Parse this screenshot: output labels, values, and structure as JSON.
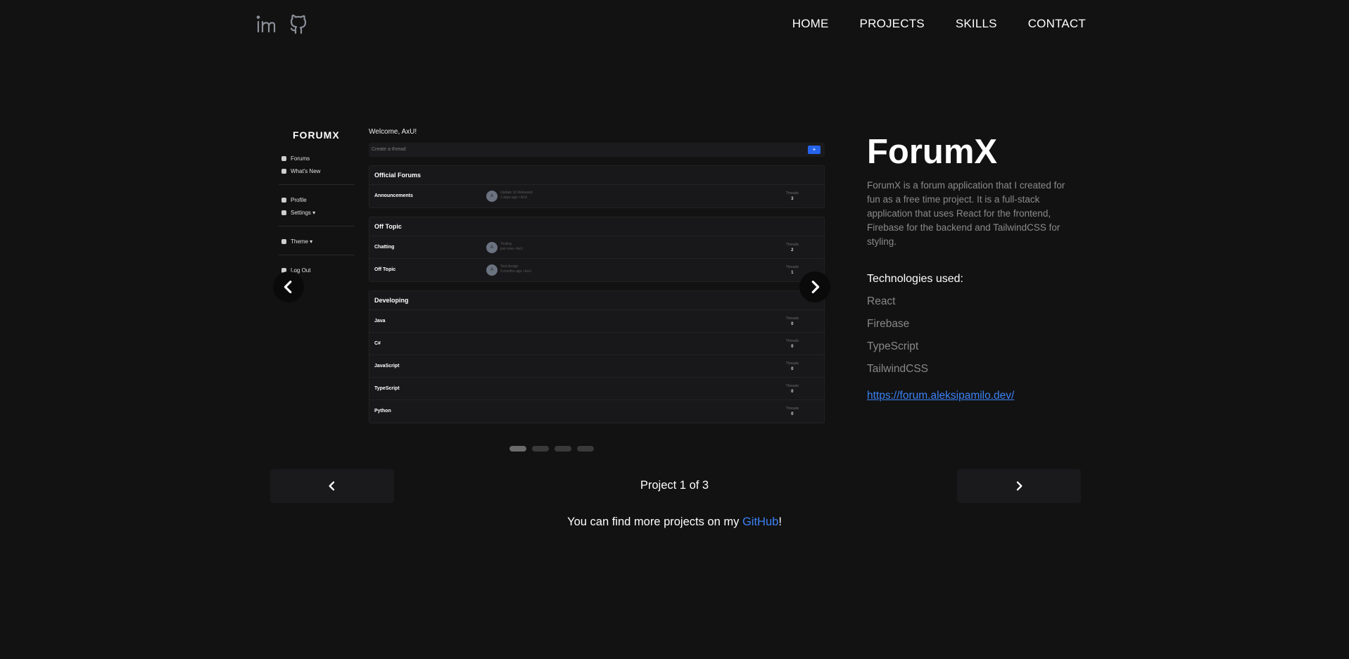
{
  "header": {
    "social": [
      {
        "icon": "linkedin-icon"
      },
      {
        "icon": "github-icon"
      }
    ],
    "nav": [
      "HOME",
      "PROJECTS",
      "SKILLS",
      "CONTACT"
    ]
  },
  "carousel": {
    "slide_count": 4,
    "active_slide": 0,
    "screenshot": {
      "logo": "FORUMX",
      "sidebar": [
        {
          "label": "Forums"
        },
        {
          "label": "What's New"
        },
        {
          "label": "Profile"
        },
        {
          "label": "Settings ▾"
        },
        {
          "label": "Theme ▾"
        },
        {
          "label": "Log Out"
        }
      ],
      "welcome": "Welcome, AxU!",
      "create_placeholder": "Create a thread",
      "create_button": "+",
      "threads_label": "Threads",
      "sections": [
        {
          "title": "Official Forums",
          "rows": [
            {
              "name": "Announcements",
              "avatar": "A",
              "meta1": "Update 10 Released",
              "meta2": "1 days ago • AxU",
              "threads": "3"
            }
          ]
        },
        {
          "title": "Off Topic",
          "rows": [
            {
              "name": "Chatting",
              "avatar": "A",
              "meta1": "Testing",
              "meta2": "just now • AxU",
              "threads": "2"
            },
            {
              "name": "Off Topic",
              "avatar": "A",
              "meta1": "Test design",
              "meta2": "5 months ago • AxU",
              "threads": "1"
            }
          ]
        },
        {
          "title": "Developing",
          "rows": [
            {
              "name": "Java",
              "threads": "0"
            },
            {
              "name": "C#",
              "threads": "0"
            },
            {
              "name": "JavaScript",
              "threads": "0"
            },
            {
              "name": "TypeScript",
              "threads": "0"
            },
            {
              "name": "Python",
              "threads": "0"
            }
          ]
        }
      ]
    }
  },
  "project": {
    "title": "ForumX",
    "description": "ForumX is a forum application that I created for fun as a free time project. It is a full-stack application that uses React for the frontend, Firebase for the backend and TailwindCSS for styling.",
    "tech_heading": "Technologies used:",
    "technologies": [
      "React",
      "Firebase",
      "TypeScript",
      "TailwindCSS"
    ],
    "link": "https://forum.aleksipamilo.dev/"
  },
  "pager": {
    "counter": "Project 1 of 3",
    "more_prefix": "You can find more projects on my ",
    "more_link": "GitHub",
    "more_suffix": "!"
  },
  "colors": {
    "background": "#121212",
    "link": "#3b82f6",
    "muted_text": "#8a8a8a"
  }
}
